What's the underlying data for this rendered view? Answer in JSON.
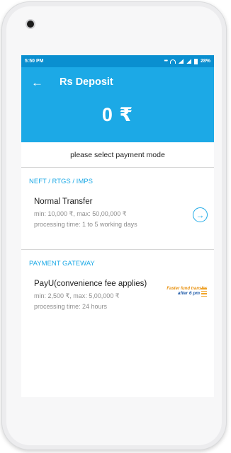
{
  "status_bar": {
    "time": "5:50 PM",
    "battery": "28%"
  },
  "header": {
    "title": "Rs Deposit",
    "amount": "0 ₹"
  },
  "prompt": "please select payment mode",
  "sections": [
    {
      "label": "NEFT / RTGS / IMPS",
      "option": {
        "title": "Normal Transfer",
        "limits": "min: 10,000 ₹, max: 50,00,000 ₹",
        "processing": "processing time: 1 to 5 working days"
      }
    },
    {
      "label": "PAYMENT GATEWAY",
      "option": {
        "title": "PayU(convenience fee applies)",
        "limits": "min: 2,500 ₹, max: 5,00,000 ₹",
        "processing": "processing time: 24 hours",
        "badge_line1": "Faster fund transfer",
        "badge_line2": "after 6 pm"
      }
    }
  ],
  "colors": {
    "accent": "#1ca9e6",
    "status_bar": "#0a8fd0",
    "badge_orange": "#e8900c",
    "badge_blue": "#1e5aa8"
  },
  "icons": [
    "back-arrow-icon",
    "arrow-right-circle-icon",
    "wifi-icon",
    "signal-icon",
    "battery-icon"
  ]
}
